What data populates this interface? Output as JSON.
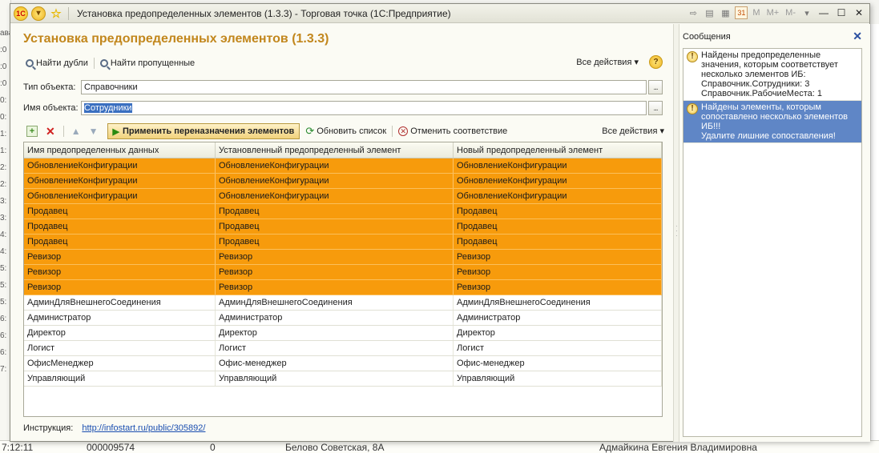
{
  "window": {
    "title": "Установка предопределенных элементов (1.3.3) - Торговая точка  (1С:Предприятие)",
    "toolbar_calendar": "31",
    "memory_buttons": [
      "M",
      "M+",
      "M-"
    ]
  },
  "form": {
    "title": "Установка предопределенных элементов (1.3.3)",
    "top_toolbar": {
      "find_duplicates": "Найти дубли",
      "find_missing": "Найти пропущенные",
      "all_actions": "Все действия ▾",
      "help": "?"
    },
    "object_type": {
      "label": "Тип объекта:",
      "value": "Справочники"
    },
    "object_name": {
      "label": "Имя объекта:",
      "value": "Сотрудники"
    },
    "list_toolbar": {
      "apply": "Применить переназначения элементов",
      "refresh": "Обновить список",
      "cancel_match": "Отменить соответствие",
      "all_actions": "Все действия ▾"
    },
    "table": {
      "columns": [
        "Имя предопределенных данных",
        "Установленный предопределенный элемент",
        "Новый предопределенный элемент"
      ],
      "rows": [
        {
          "cells": [
            "ОбновлениеКонфигурации",
            "ОбновлениеКонфигурации",
            "ОбновлениеКонфигурации"
          ],
          "highlight": true
        },
        {
          "cells": [
            "ОбновлениеКонфигурации",
            "ОбновлениеКонфигурации",
            "ОбновлениеКонфигурации"
          ],
          "highlight": true
        },
        {
          "cells": [
            "ОбновлениеКонфигурации",
            "ОбновлениеКонфигурации",
            "ОбновлениеКонфигурации"
          ],
          "highlight": true
        },
        {
          "cells": [
            "Продавец",
            "Продавец",
            "Продавец"
          ],
          "highlight": true
        },
        {
          "cells": [
            "Продавец",
            "Продавец",
            "Продавец"
          ],
          "highlight": true
        },
        {
          "cells": [
            "Продавец",
            "Продавец",
            "Продавец"
          ],
          "highlight": true
        },
        {
          "cells": [
            "Ревизор",
            "Ревизор",
            "Ревизор"
          ],
          "highlight": true
        },
        {
          "cells": [
            "Ревизор",
            "Ревизор",
            "Ревизор"
          ],
          "highlight": true
        },
        {
          "cells": [
            "Ревизор",
            "Ревизор",
            "Ревизор"
          ],
          "highlight": true
        },
        {
          "cells": [
            "АдминДляВнешнегоСоединения",
            "АдминДляВнешнегоСоединения",
            "АдминДляВнешнегоСоединения"
          ],
          "highlight": false
        },
        {
          "cells": [
            "Администратор",
            "Администратор",
            "Администратор"
          ],
          "highlight": false
        },
        {
          "cells": [
            "Директор",
            "Директор",
            "Директор"
          ],
          "highlight": false
        },
        {
          "cells": [
            "Логист",
            "Логист",
            "Логист"
          ],
          "highlight": false
        },
        {
          "cells": [
            "ОфисМенеджер",
            "Офис-менеджер",
            "Офис-менеджер"
          ],
          "highlight": false
        },
        {
          "cells": [
            "Управляющий",
            "Управляющий",
            "Управляющий"
          ],
          "highlight": false
        }
      ],
      "highlight_color": "#f79b0c"
    },
    "instruction": {
      "label": "Инструкция:",
      "link": "http://infostart.ru/public/305892/"
    }
  },
  "messages": {
    "title": "Сообщения",
    "items": [
      {
        "lines": [
          "Найдены предопределенные",
          "значения, которым соответствует",
          "несколько элементов ИБ:",
          "Справочник.Сотрудники: 3",
          "Справочник.РабочиеМеста: 1"
        ],
        "selected": false
      },
      {
        "lines": [
          "Найдены элементы, которым",
          "сопоставлено несколько элементов",
          "ИБ!!!",
          "Удалите лишние сопоставления!"
        ],
        "selected": true
      }
    ]
  },
  "background": {
    "left_fragments": [
      "ава",
      ":0",
      ":0",
      ":0",
      "0:",
      "0:",
      "1:",
      "1:",
      "2:",
      "2:",
      "3:",
      "3:",
      "4:",
      "4:",
      "5:",
      "5:",
      "5:",
      "6:",
      "6:",
      "6:",
      "7:"
    ],
    "bottom_row": [
      "7:12:11",
      "000009574",
      "0",
      "Белово Советская, 8А",
      "Адмайкина Евгения Владимировна"
    ]
  }
}
